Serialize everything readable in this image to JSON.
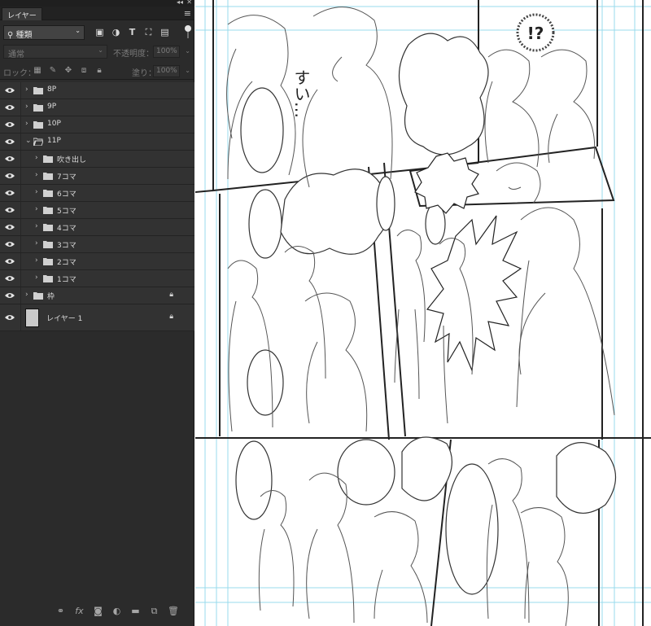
{
  "panel": {
    "tab_label": "レイヤー",
    "collapse_icon": "double-chevron-left-icon",
    "close_icon": "close-icon",
    "menu_icon": "hamburger-menu-icon",
    "filter": {
      "selected": "種類",
      "icons": [
        "image-filter-icon",
        "adjustment-filter-icon",
        "type-filter-icon",
        "shape-filter-icon",
        "smart-object-filter-icon"
      ]
    },
    "blend_mode": "通常",
    "opacity_label": "不透明度：",
    "opacity_value": "100%",
    "lock_label": "ロック：",
    "fill_label": "塗り：",
    "fill_value": "100%",
    "layers": [
      {
        "name": "8P",
        "type": "group",
        "level": 0,
        "expanded": false,
        "locked": false
      },
      {
        "name": "9P",
        "type": "group",
        "level": 0,
        "expanded": false,
        "locked": false
      },
      {
        "name": "10P",
        "type": "group",
        "level": 0,
        "expanded": false,
        "locked": false
      },
      {
        "name": "11P",
        "type": "group",
        "level": 0,
        "expanded": true,
        "locked": false
      },
      {
        "name": "吹き出し",
        "type": "group",
        "level": 1,
        "expanded": false,
        "locked": false
      },
      {
        "name": "7コマ",
        "type": "group",
        "level": 1,
        "expanded": false,
        "locked": false
      },
      {
        "name": "6コマ",
        "type": "group",
        "level": 1,
        "expanded": false,
        "locked": false
      },
      {
        "name": "5コマ",
        "type": "group",
        "level": 1,
        "expanded": false,
        "locked": false
      },
      {
        "name": "4コマ",
        "type": "group",
        "level": 1,
        "expanded": false,
        "locked": false
      },
      {
        "name": "3コマ",
        "type": "group",
        "level": 1,
        "expanded": false,
        "locked": false
      },
      {
        "name": "2コマ",
        "type": "group",
        "level": 1,
        "expanded": false,
        "locked": false
      },
      {
        "name": "1コマ",
        "type": "group",
        "level": 1,
        "expanded": false,
        "locked": false
      },
      {
        "name": "枠",
        "type": "group",
        "level": 0,
        "expanded": false,
        "locked": true
      },
      {
        "name": "レイヤー 1",
        "type": "pixel",
        "level": 0,
        "expanded": false,
        "locked": true
      }
    ],
    "bottom_icons": [
      "link-icon",
      "fx-icon",
      "mask-icon",
      "adjustment-layer-icon",
      "new-group-icon",
      "new-layer-icon",
      "trash-icon"
    ]
  },
  "canvas": {
    "sfx_vertical": "すい…",
    "sfx_burst": "!?"
  }
}
